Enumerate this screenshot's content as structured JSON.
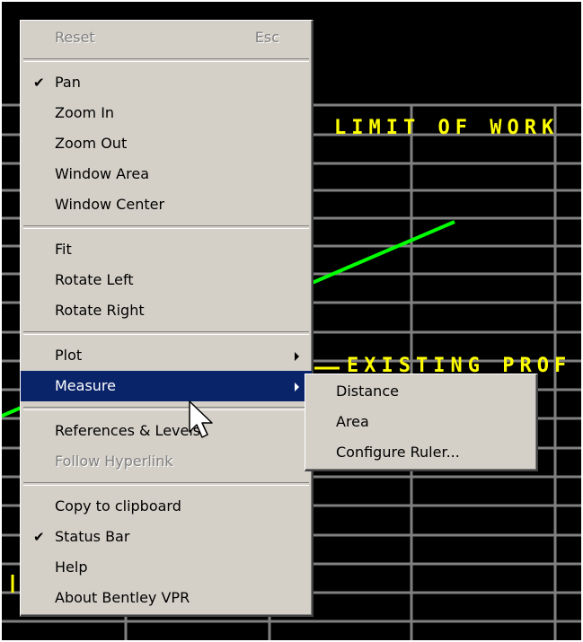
{
  "drawing": {
    "annotations": {
      "limit_of_work": "LIMIT OF WORK",
      "existing_profile": "EXISTING PROF"
    },
    "colors": {
      "background": "#000000",
      "grid": "#808080",
      "profile_line": "#00ff00",
      "text": "#ffff00"
    }
  },
  "context_menu": {
    "items": [
      {
        "label": "Reset",
        "shortcut": "Esc",
        "enabled": false
      },
      {
        "separator": true
      },
      {
        "label": "Pan",
        "checked": true
      },
      {
        "label": "Zoom In"
      },
      {
        "label": "Zoom Out"
      },
      {
        "label": "Window Area"
      },
      {
        "label": "Window Center"
      },
      {
        "separator": true
      },
      {
        "label": "Fit"
      },
      {
        "label": "Rotate Left"
      },
      {
        "label": "Rotate Right"
      },
      {
        "separator": true
      },
      {
        "label": "Plot",
        "submenu": true
      },
      {
        "label": "Measure",
        "submenu": true,
        "selected": true
      },
      {
        "separator": true
      },
      {
        "label": "References & Levels"
      },
      {
        "label": "Follow Hyperlink",
        "enabled": false
      },
      {
        "separator": true
      },
      {
        "label": "Copy to clipboard"
      },
      {
        "label": "Status Bar",
        "checked": true
      },
      {
        "label": "Help"
      },
      {
        "label": "About Bentley VPR"
      }
    ]
  },
  "measure_submenu": {
    "items": [
      {
        "label": "Distance"
      },
      {
        "label": "Area"
      },
      {
        "label": "Configure Ruler..."
      }
    ]
  },
  "icons": {
    "check": "check-mark-icon",
    "submenu_arrow": "submenu-arrow-icon",
    "cursor": "mouse-pointer-icon"
  },
  "colors": {
    "menu_face": "#d4d0c8",
    "highlight": "#0a246a",
    "disabled_text": "#808080"
  }
}
